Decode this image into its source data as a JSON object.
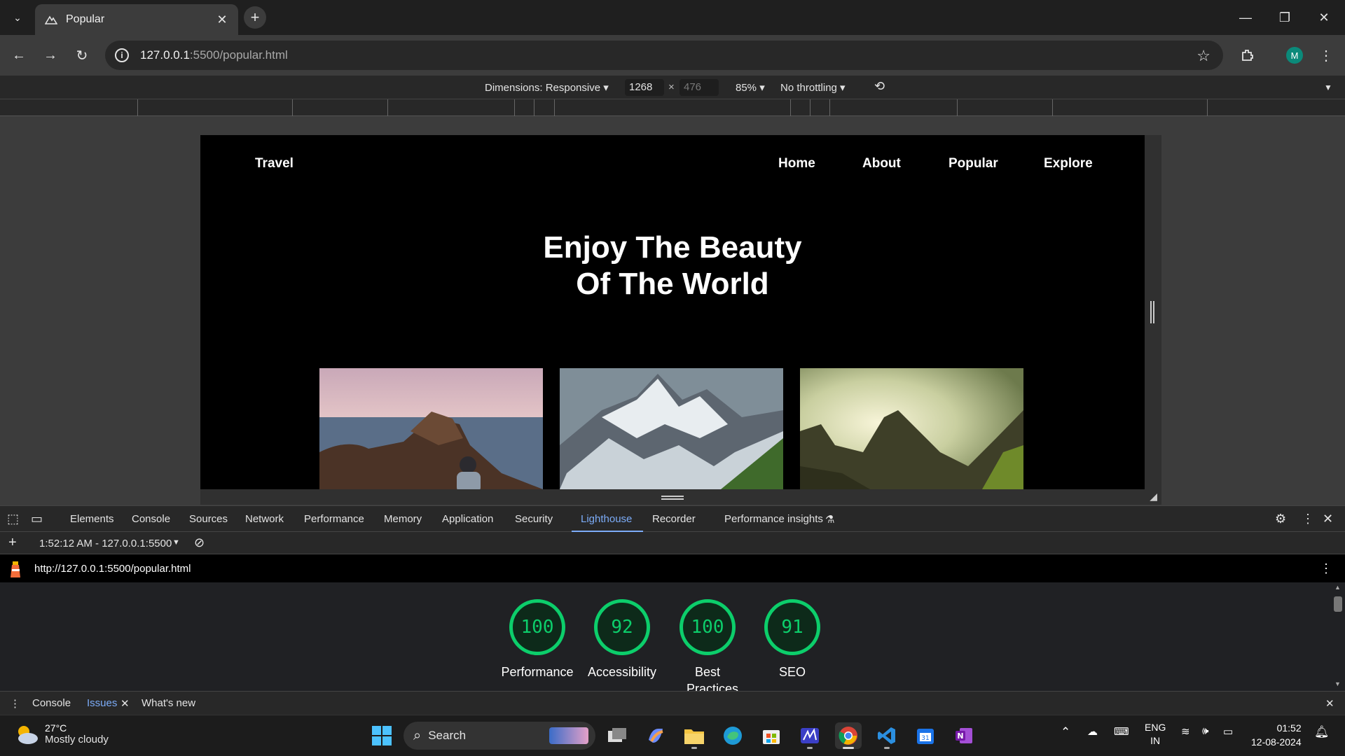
{
  "browser": {
    "tab_title": "Popular",
    "url_host": "127.0.0.1",
    "url_rest": ":5500/popular.html",
    "avatar_letter": "M"
  },
  "device_toolbar": {
    "dimensions": "Dimensions: Responsive ▾",
    "width": "1268",
    "height": "476",
    "zoom": "85% ▾",
    "throttling": "No throttling ▾"
  },
  "site": {
    "brand": "Travel",
    "nav": [
      "Home",
      "About",
      "Popular",
      "Explore"
    ],
    "hero_line1": "Enjoy The Beauty",
    "hero_line2": "Of The World"
  },
  "devtools": {
    "tabs": [
      "Elements",
      "Console",
      "Sources",
      "Network",
      "Performance",
      "Memory",
      "Application",
      "Security",
      "Lighthouse",
      "Recorder",
      "Performance insights"
    ],
    "active_tab": "Lighthouse",
    "report_selector": "1:52:12 AM - 127.0.0.1:5500",
    "report_url": "http://127.0.0.1:5500/popular.html",
    "scores": [
      {
        "label": "Performance",
        "value": "100"
      },
      {
        "label": "Accessibility",
        "value": "92"
      },
      {
        "label": "Best Practices",
        "value": "100"
      },
      {
        "label": "SEO",
        "value": "91"
      }
    ],
    "score_color": "#0cce6b",
    "drawer": [
      "Console",
      "Issues",
      "What's new"
    ]
  },
  "taskbar": {
    "temperature": "27°C",
    "condition": "Mostly cloudy",
    "search": "Search",
    "lang1": "ENG",
    "lang2": "IN",
    "time": "01:52",
    "date": "12-08-2024"
  }
}
